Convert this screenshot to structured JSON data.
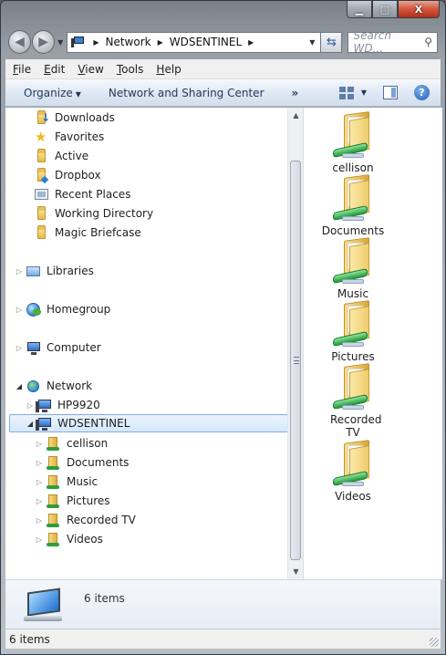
{
  "window": {
    "controls": {
      "minimize": "▁",
      "maximize": "□",
      "close": "X"
    }
  },
  "address": {
    "back_icon": "back-arrow-icon",
    "forward_icon": "forward-arrow-icon",
    "crumbs": [
      "Network",
      "WDSENTINEL"
    ],
    "search_placeholder": "Search WD..."
  },
  "menu": {
    "items": [
      {
        "label": "File",
        "key": "F"
      },
      {
        "label": "Edit",
        "key": "E"
      },
      {
        "label": "View",
        "key": "V"
      },
      {
        "label": "Tools",
        "key": "T"
      },
      {
        "label": "Help",
        "key": "H"
      }
    ]
  },
  "commandbar": {
    "organize": "Organize",
    "network_sharing": "Network and Sharing Center",
    "more": "»"
  },
  "tree": {
    "favorites": [
      {
        "label": "Downloads",
        "icon": "downloads-folder-icon"
      },
      {
        "label": "Favorites",
        "icon": "star-icon"
      },
      {
        "label": "Active",
        "icon": "folder-icon"
      },
      {
        "label": "Dropbox",
        "icon": "dropbox-folder-icon"
      },
      {
        "label": "Recent Places",
        "icon": "recent-places-icon"
      },
      {
        "label": "Working Directory",
        "icon": "folder-icon"
      },
      {
        "label": "Magic Briefcase",
        "icon": "folder-icon"
      }
    ],
    "libraries": "Libraries",
    "homegroup": "Homegroup",
    "computer": "Computer",
    "network": "Network",
    "hosts": [
      "HP9920",
      "WDSENTINEL"
    ],
    "shares": [
      "cellison",
      "Documents",
      "Music",
      "Pictures",
      "Recorded TV",
      "Videos"
    ]
  },
  "content": {
    "items": [
      {
        "label": "cellison"
      },
      {
        "label": "Documents"
      },
      {
        "label": "Music"
      },
      {
        "label": "Pictures"
      },
      {
        "label": "Recorded TV"
      },
      {
        "label": "Videos"
      }
    ]
  },
  "details": {
    "count": "6 items"
  },
  "status": {
    "text": "6 items"
  }
}
